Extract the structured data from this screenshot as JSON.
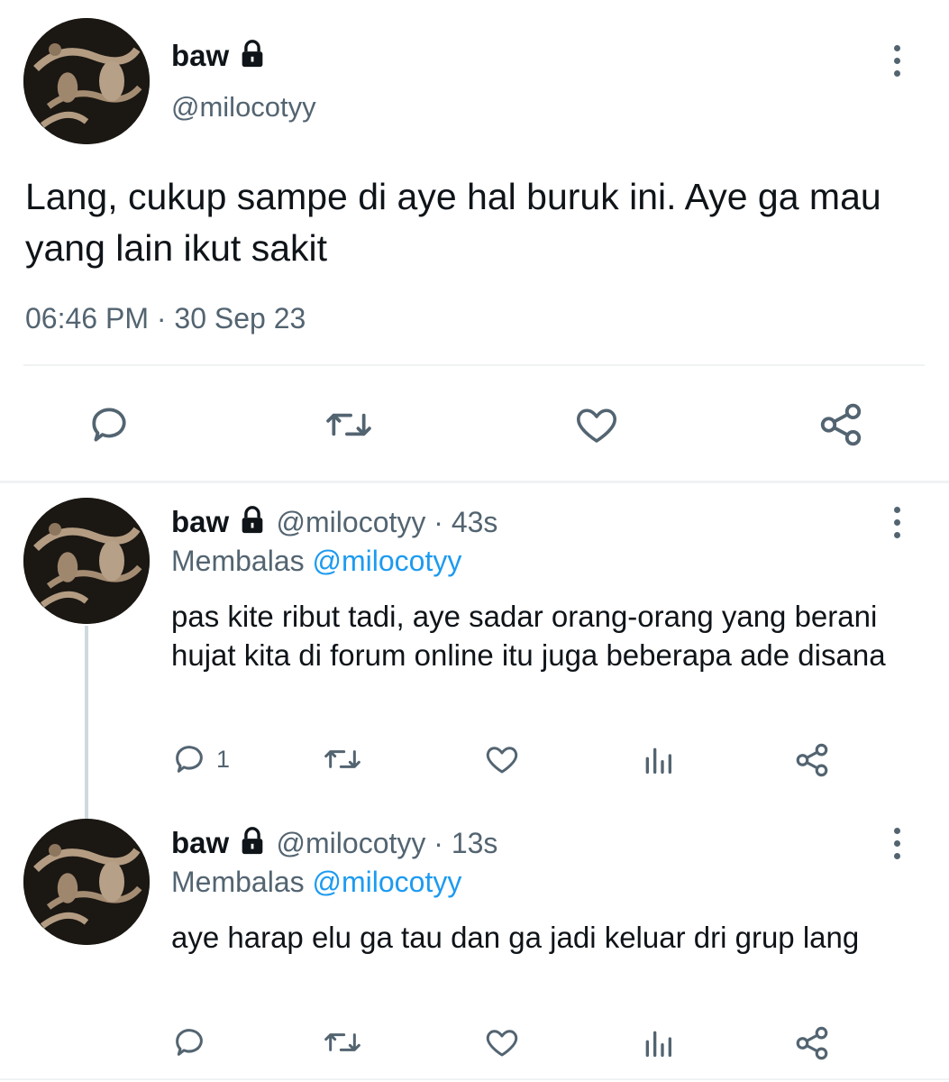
{
  "main_tweet": {
    "display_name": "baw",
    "handle": "@milocotyy",
    "text": "Lang, cukup sampe di aye hal buruk ini. Aye ga mau yang lain ikut sakit",
    "timestamp": "06:46 PM · 30 Sep 23"
  },
  "replies": [
    {
      "display_name": "baw",
      "meta": "@milocotyy · 43s",
      "replying_prefix": "Membalas",
      "replying_to": "@milocotyy",
      "text": "pas kite ribut tadi, aye sadar orang-orang yang berani hujat kita di forum online itu juga beberapa ade disana",
      "reply_count": "1"
    },
    {
      "display_name": "baw",
      "meta": "@milocotyy · 13s",
      "replying_prefix": "Membalas",
      "replying_to": "@milocotyy",
      "text": "aye harap elu ga tau dan ga jadi keluar dri grup lang",
      "reply_count": ""
    }
  ],
  "icons": {
    "lock": "lock-icon",
    "more": "more-icon",
    "reply": "reply-icon",
    "retweet": "retweet-icon",
    "like": "heart-icon",
    "views": "views-icon",
    "share": "share-icon"
  },
  "colors": {
    "text": "#0f1419",
    "muted": "#536471",
    "link": "#1d9bf0",
    "divider": "#eff3f4",
    "thread_line": "#cfd9de"
  }
}
